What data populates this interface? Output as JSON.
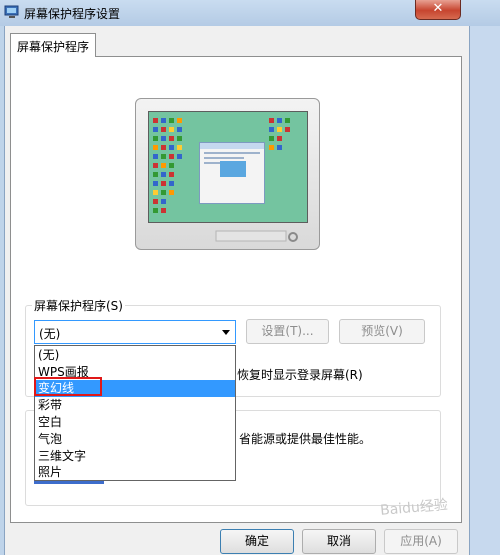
{
  "window": {
    "title": "屏幕保护程序设置",
    "close_glyph": "✕"
  },
  "tabs": [
    {
      "label": "屏幕保护程序"
    }
  ],
  "screensaver_group": {
    "label": "屏幕保护程序(S)",
    "selected": "(无)",
    "settings_button": "设置(T)...",
    "preview_button": "预览(V)",
    "resume_text": "恢复时显示登录屏幕(R)"
  },
  "dropdown_options": [
    "(无)",
    "WPS画报",
    "变幻线",
    "彩带",
    "空白",
    "气泡",
    "三维文字",
    "照片"
  ],
  "dropdown_highlighted": "变幻线",
  "power_group": {
    "partial_text": "省能源或提供最佳性能。"
  },
  "footer": {
    "ok": "确定",
    "cancel": "取消",
    "apply": "应用(A)"
  },
  "watermark": "Baidu经验",
  "colors": {
    "selection": "#3399ff",
    "highlight_box": "#e01818",
    "screen_bg": "#74c4a0"
  }
}
